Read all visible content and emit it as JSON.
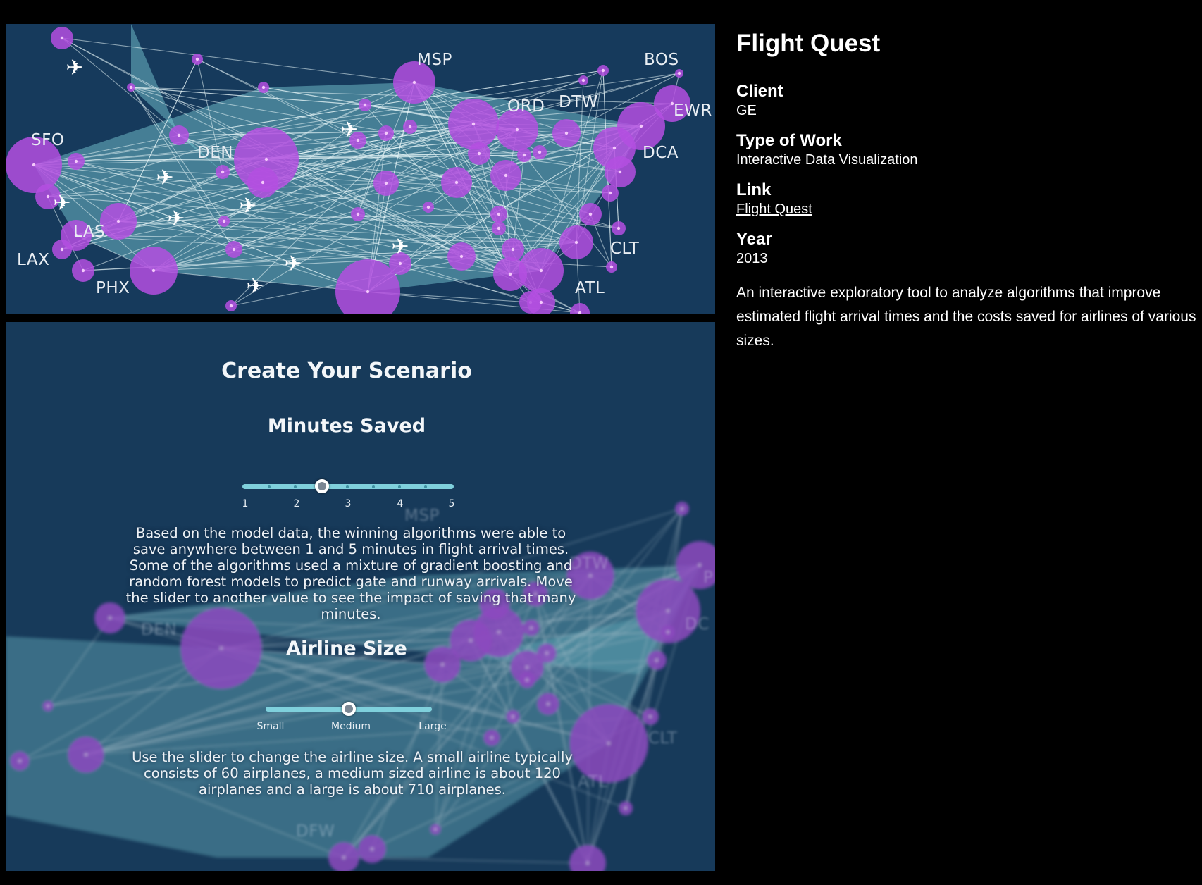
{
  "map": {
    "cities": [
      "MSP",
      "BOS",
      "ORD",
      "DTW",
      "EWR",
      "SFO",
      "DEN",
      "DCA",
      "LAS",
      "CLT",
      "LAX",
      "PHX",
      "ATL"
    ]
  },
  "scenario": {
    "title": "Create Your Scenario",
    "minutes": {
      "heading": "Minutes Saved",
      "ticks": [
        "1",
        "2",
        "3",
        "4",
        "5"
      ],
      "value": 2.5,
      "description": "Based on the model data, the winning algorithms were able to save anywhere between 1 and 5 minutes in flight arrival times. Some of the algorithms used a mixture of gradient boosting and random forest models to predict gate and runway arrivals. Move the slider to another value to see the impact of saving that many minutes."
    },
    "airline": {
      "heading": "Airline Size",
      "ticks": [
        "Small",
        "Medium",
        "Large"
      ],
      "value": "Medium",
      "description": "Use the slider to change the airline size. A small airline typically consists of 60 airplanes, a medium sized airline is about 120 airplanes and a large is about 710 airplanes."
    },
    "background_cities": [
      "MSP",
      "DTW",
      "DEN",
      "DC",
      "P",
      "CLT",
      "ATL",
      "DFW"
    ]
  },
  "project": {
    "title": "Flight Quest",
    "client_label": "Client",
    "client": "GE",
    "type_label": "Type of Work",
    "type": "Interactive Data Visualization",
    "link_label": "Link",
    "link_text": "Flight Quest",
    "year_label": "Year",
    "year": "2013",
    "description": "An interactive exploratory tool to analyze algorithms that improve estimated flight arrival times and the costs saved for airlines of various sizes."
  },
  "colors": {
    "background": "#000000",
    "map_bg": "#163a5c",
    "route_fill": "#7fd3dc",
    "airport": "#b44fe0",
    "airport_core": "#e15cf5"
  }
}
